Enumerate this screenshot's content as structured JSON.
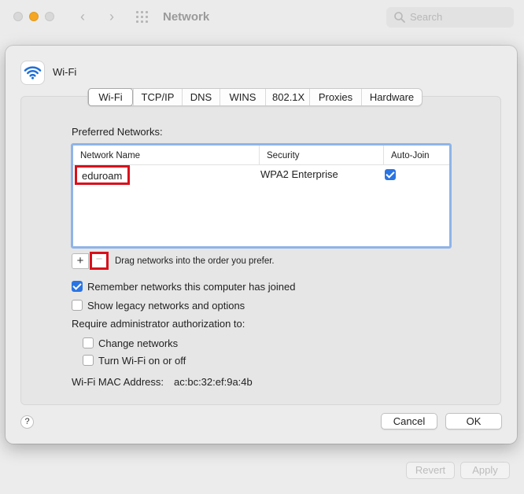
{
  "window": {
    "title": "Network",
    "search_placeholder": "Search",
    "revert_label": "Revert",
    "apply_label": "Apply"
  },
  "sheet": {
    "title": "Wi-Fi",
    "tabs": [
      {
        "label": "Wi-Fi",
        "active": true
      },
      {
        "label": "TCP/IP",
        "active": false
      },
      {
        "label": "DNS",
        "active": false
      },
      {
        "label": "WINS",
        "active": false
      },
      {
        "label": "802.1X",
        "active": false
      },
      {
        "label": "Proxies",
        "active": false
      },
      {
        "label": "Hardware",
        "active": false
      }
    ],
    "preferred_networks_label": "Preferred Networks:",
    "table": {
      "columns": [
        "Network Name",
        "Security",
        "Auto-Join"
      ],
      "rows": [
        {
          "name": "eduroam",
          "security": "WPA2 Enterprise",
          "auto_join": true
        }
      ]
    },
    "add_symbol": "+",
    "remove_symbol": "−",
    "drag_hint": "Drag networks into the order you prefer.",
    "remember_networks": {
      "label": "Remember networks this computer has joined",
      "checked": true
    },
    "show_legacy": {
      "label": "Show legacy networks and options",
      "checked": false
    },
    "require_admin_label": "Require administrator authorization to:",
    "change_networks": {
      "label": "Change networks",
      "checked": false
    },
    "turn_wifi": {
      "label": "Turn Wi-Fi on or off",
      "checked": false
    },
    "mac_label": "Wi-Fi MAC Address:",
    "mac_value": "ac:bc:32:ef:9a:4b",
    "help_label": "?",
    "cancel_label": "Cancel",
    "ok_label": "OK"
  },
  "colors": {
    "accent": "#2a74e3",
    "highlight_red": "#d8101c",
    "wifi_icon": "#1f6fd6"
  }
}
